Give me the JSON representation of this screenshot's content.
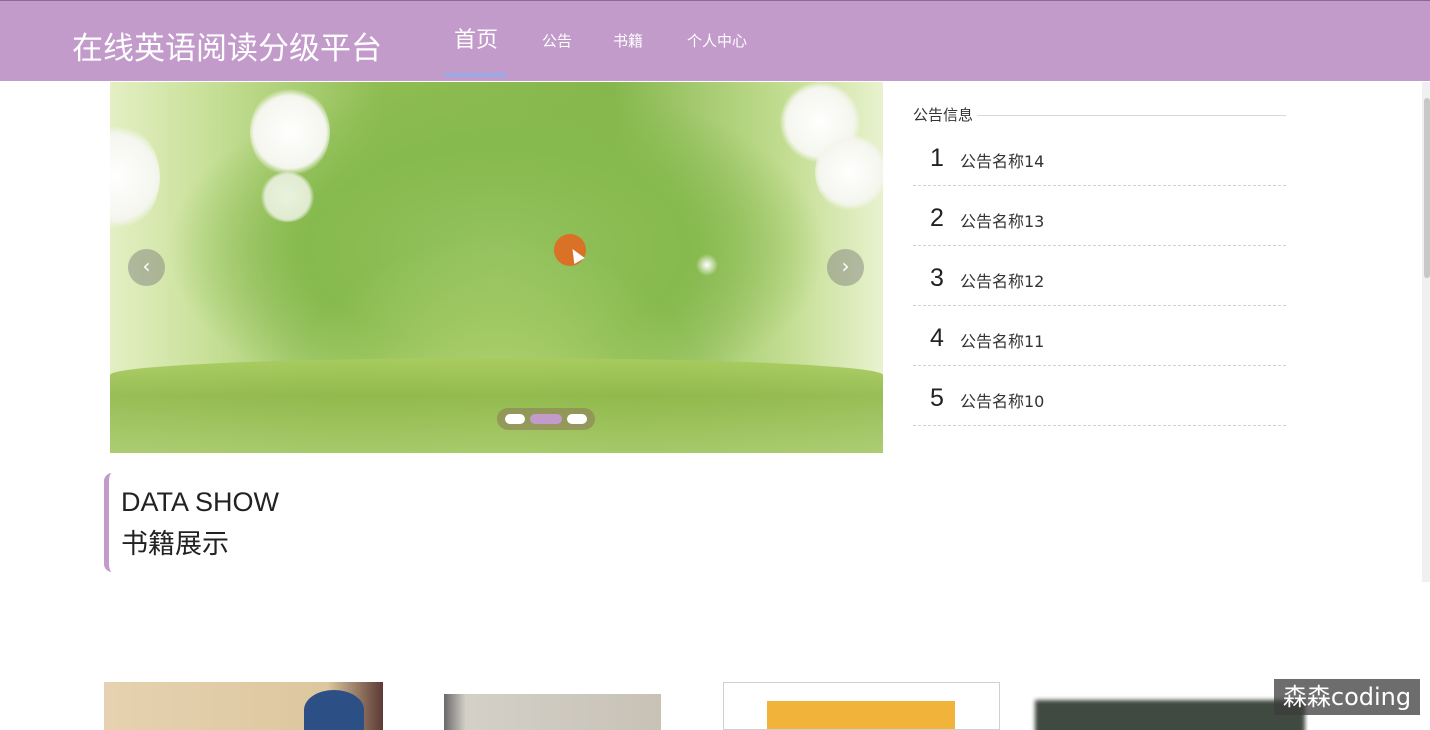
{
  "header": {
    "brand": "在线英语阅读分级平台",
    "nav": [
      {
        "label": "首页",
        "active": true
      },
      {
        "label": "公告",
        "active": false
      },
      {
        "label": "书籍",
        "active": false
      },
      {
        "label": "个人中心",
        "active": false
      }
    ]
  },
  "carousel": {
    "prev_icon": "chevron-left-icon",
    "next_icon": "chevron-right-icon",
    "prev_glyph": "‹",
    "next_glyph": "›",
    "slide_count": 3,
    "active_index": 1
  },
  "notice": {
    "heading": "公告信息",
    "items": [
      {
        "num": "1",
        "title": "公告名称14"
      },
      {
        "num": "2",
        "title": "公告名称13"
      },
      {
        "num": "3",
        "title": "公告名称12"
      },
      {
        "num": "4",
        "title": "公告名称11"
      },
      {
        "num": "5",
        "title": "公告名称10"
      }
    ]
  },
  "section": {
    "title_en": "DATA SHOW",
    "title_cn": "书籍展示"
  },
  "watermark": "森森coding",
  "colors": {
    "header": "#c29bcb",
    "accent": "#c29bcb",
    "nav_underline": "#9aa8e6"
  }
}
